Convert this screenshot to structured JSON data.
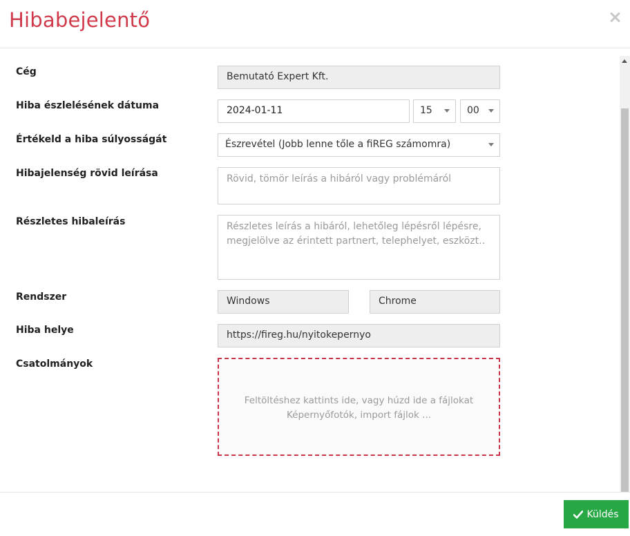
{
  "dialog": {
    "title": "Hibabejelentő",
    "close_icon": "close-icon"
  },
  "form": {
    "company": {
      "label": "Cég",
      "value": "Bemutató Expert Kft."
    },
    "date": {
      "label": "Hiba észlelésének dátuma",
      "value": "2024-01-11",
      "hour": "15",
      "minute": "00"
    },
    "severity": {
      "label": "Értékeld a hiba súlyosságát",
      "value": "Észrevétel (Jobb lenne tőle a fiREG számomra)"
    },
    "short_desc": {
      "label": "Hibajelenség rövid leírása",
      "placeholder": "Rövid, tömör leírás a hibáról vagy problémáról"
    },
    "detailed_desc": {
      "label": "Részletes hibaleírás",
      "placeholder_line1": "Részletes leírás a hibáról, lehetőleg lépésről lépésre,",
      "placeholder_line2": "megjelölve az érintett partnert, telephelyet, eszközt.."
    },
    "system": {
      "label": "Rendszer",
      "os": "Windows",
      "browser": "Chrome"
    },
    "location": {
      "label": "Hiba helye",
      "value": "https://fireg.hu/nyitokepernyo"
    },
    "attachments": {
      "label": "Csatolmányok",
      "line1": "Feltöltéshez kattints ide, vagy húzd ide a fájlokat",
      "line2": "Képernyőfotók, import fájlok ..."
    }
  },
  "footer": {
    "send_label": "Küldés",
    "send_icon": "check-icon"
  },
  "colors": {
    "title": "#d03a4a",
    "send_button": "#28a745",
    "dropzone_border": "#c8334a"
  }
}
